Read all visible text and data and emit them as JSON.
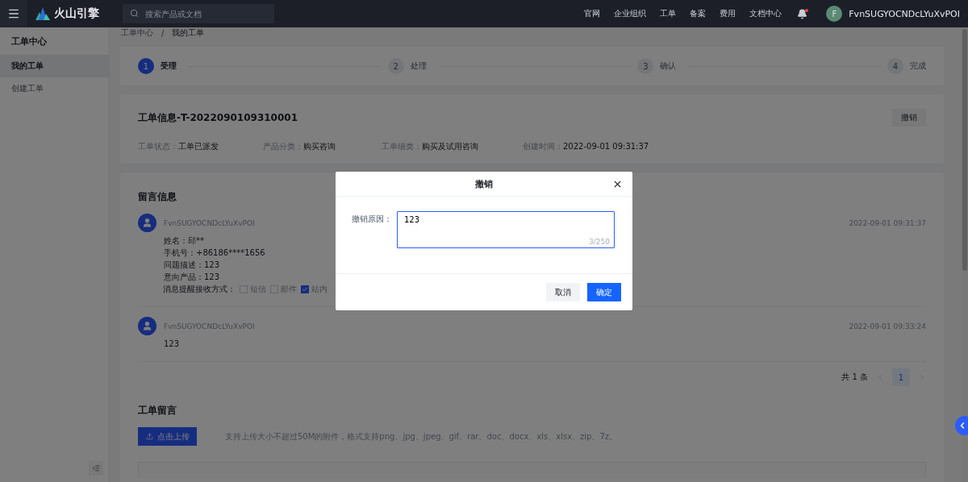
{
  "header": {
    "logo_text": "火山引擎",
    "search": {
      "placeholder": "搜索产品或文档"
    },
    "nav": [
      "官网",
      "企业组织",
      "工单",
      "备案",
      "费用",
      "文档中心"
    ],
    "notifications": {
      "unread": true
    },
    "user": {
      "avatar_letter": "F",
      "name": "FvnSUGYOCNDcLYuXvPOI"
    }
  },
  "sidebar": {
    "title": "工单中心",
    "items": [
      {
        "label": "我的工单",
        "selected": true
      },
      {
        "label": "创建工单",
        "selected": false
      }
    ]
  },
  "breadcrumb": [
    "工单中心",
    "我的工单"
  ],
  "breadcrumb_separator": "/",
  "steps": [
    {
      "number": "1",
      "label": "受理",
      "active": true
    },
    {
      "number": "2",
      "label": "处理",
      "active": false
    },
    {
      "number": "3",
      "label": "确认",
      "active": false
    },
    {
      "number": "4",
      "label": "完成",
      "active": false
    }
  ],
  "ticket": {
    "title": "工单信息-T-2022090109310001",
    "revoke_button": "撤销",
    "fields": [
      {
        "label": "工单状态：",
        "value": "工单已派发"
      },
      {
        "label": "产品分类：",
        "value": "购买咨询"
      },
      {
        "label": "工单细类：",
        "value": "购买及试用咨询"
      },
      {
        "label": "创建时间：",
        "value": "2022-09-01 09:31:37"
      }
    ]
  },
  "messages": {
    "title": "留言信息",
    "items": [
      {
        "author": "FvnSUGYOCNDcLYuXvPOI",
        "time": "2022-09-01 09:31:37",
        "lines": [
          "姓名：邱**",
          "手机号：+86186****1656",
          "问题描述：123",
          "意向产品：123"
        ],
        "notify_label": "消息提醒接收方式：",
        "options": [
          {
            "label": "短信",
            "checked": false
          },
          {
            "label": "邮件",
            "checked": false
          },
          {
            "label": "站内",
            "checked": true
          }
        ]
      },
      {
        "author": "FvnSUGYOCNDcLYuXvPOI",
        "time": "2022-09-01 09:33:24",
        "lines": [
          "123"
        ]
      }
    ]
  },
  "pagination": {
    "total": "共 1 条",
    "pages": [
      {
        "label": "1",
        "selected": true
      }
    ]
  },
  "reply": {
    "title": "工单留言",
    "upload_button": "点击上传",
    "hint": "支持上传大小不超过50M的附件，格式支持png、jpg、jpeg、gif、rar、doc、docx、xls、xlsx、zip、7z。"
  },
  "dialog": {
    "title": "撤销",
    "field_label": "撤销原因：",
    "value": "123",
    "counter": "3/250",
    "buttons": [
      {
        "label": "取消",
        "kind": "secondary"
      },
      {
        "label": "确定",
        "kind": "primary"
      }
    ]
  }
}
